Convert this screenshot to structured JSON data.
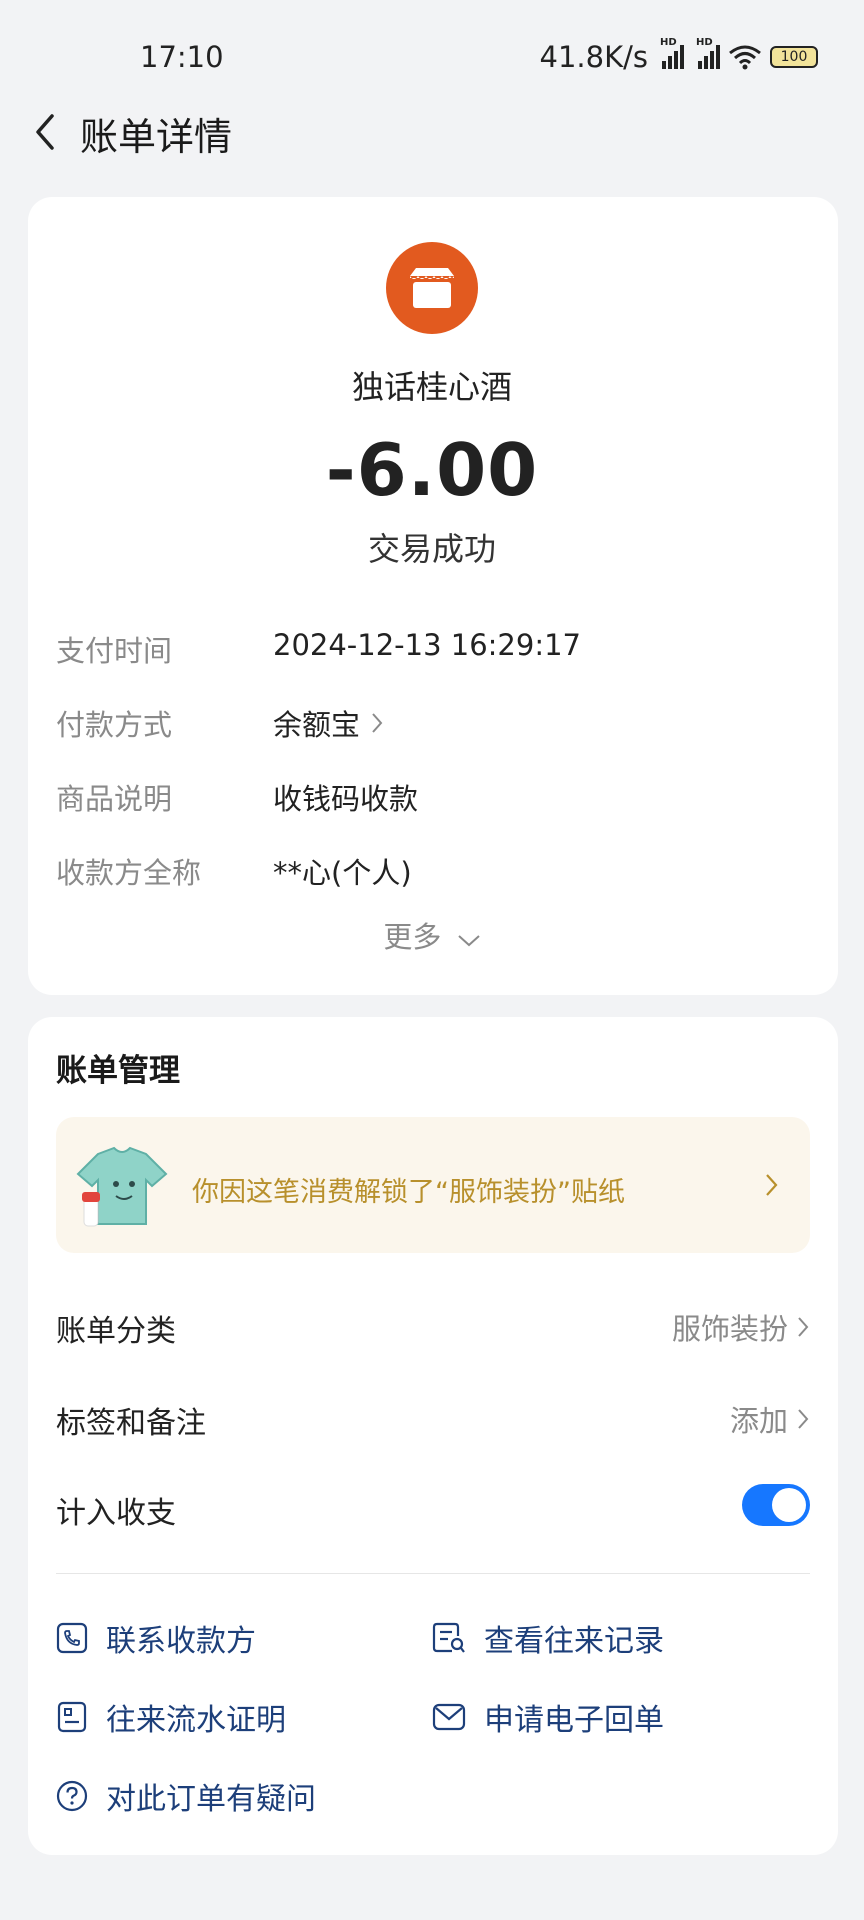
{
  "status_bar": {
    "time": "17:10",
    "net_speed": "41.8K/s",
    "battery": "100"
  },
  "header": {
    "title": "账单详情"
  },
  "bill": {
    "merchant_name": "独话桂心酒",
    "amount": "-6.00",
    "status": "交易成功",
    "details": [
      {
        "label": "支付时间",
        "value": "2024-12-13 16:29:17"
      },
      {
        "label": "付款方式",
        "value": "余额宝"
      },
      {
        "label": "商品说明",
        "value": "收钱码收款"
      },
      {
        "label": "收款方全称",
        "value": "**心(个人)"
      }
    ],
    "more_label": "更多"
  },
  "management": {
    "title": "账单管理",
    "banner_text": "你因这笔消费解锁了“服饰装扮”贴纸",
    "category": {
      "label": "账单分类",
      "value": "服饰装扮"
    },
    "tags": {
      "label": "标签和备注",
      "value": "添加"
    },
    "include": {
      "label": "计入收支",
      "on": true
    }
  },
  "actions": [
    {
      "label": "联系收款方",
      "icon": "phone-icon"
    },
    {
      "label": "查看往来记录",
      "icon": "records-search-icon"
    },
    {
      "label": "往来流水证明",
      "icon": "document-icon"
    },
    {
      "label": "申请电子回单",
      "icon": "mail-icon"
    },
    {
      "label": "对此订单有疑问",
      "icon": "question-icon"
    }
  ],
  "colors": {
    "accent": "#1677ff",
    "merchant_logo": "#e25a1f",
    "banner_text": "#b8902c",
    "action_text": "#1d3f7a",
    "background": "#f2f3f5"
  }
}
